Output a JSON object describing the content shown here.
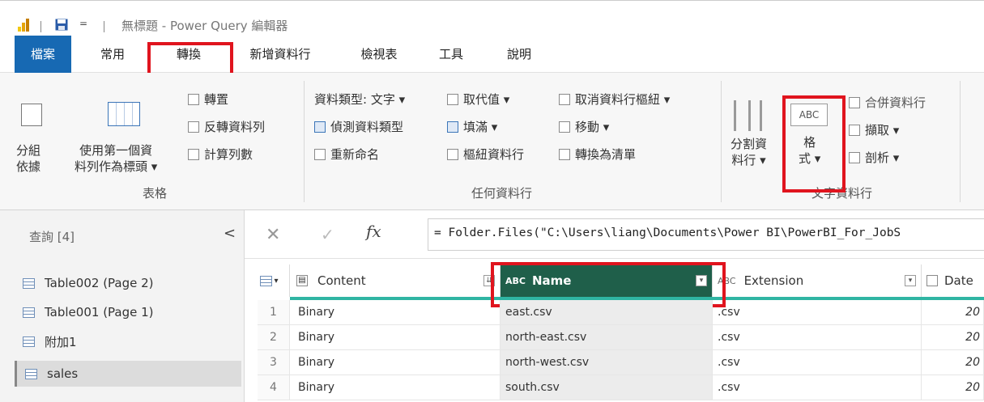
{
  "window": {
    "title": "無標題 - Power Query 編輯器",
    "qat_arrow": "="
  },
  "tabs": [
    {
      "label": "檔案"
    },
    {
      "label": "常用"
    },
    {
      "label": "轉換"
    },
    {
      "label": "新增資料行"
    },
    {
      "label": "檢視表"
    },
    {
      "label": "工具"
    },
    {
      "label": "說明"
    }
  ],
  "ribbon": {
    "group_table": {
      "label": "表格",
      "group_by": [
        "分組",
        "依據"
      ],
      "first_row_header": [
        "使用第一個資",
        "料列作為標頭 ▾"
      ],
      "transpose": "轉置",
      "reverse_rows": "反轉資料列",
      "count_rows": "計算列數"
    },
    "group_any_column": {
      "label": "任何資料行",
      "data_type": "資料類型: 文字 ▾",
      "detect_type": "偵測資料類型",
      "rename": "重新命名",
      "replace_values": "取代值 ▾",
      "fill": "填滿 ▾",
      "pivot_column": "樞紐資料行",
      "unpivot": "取消資料行樞紐 ▾",
      "move": "移動 ▾",
      "to_list": "轉換為清單"
    },
    "group_text_column": {
      "label": "文字資料行",
      "split_column": [
        "分割資",
        "料行 ▾"
      ],
      "format": [
        "格",
        "式 ▾"
      ],
      "format_icon_text": "ABC",
      "merge_columns": "合併資料行",
      "extract": "擷取 ▾",
      "parse": "剖析 ▾"
    }
  },
  "query_pane": {
    "header": "查詢 [4]",
    "collapse": "<",
    "items": [
      {
        "label": "Table002 (Page 2)"
      },
      {
        "label": "Table001 (Page 1)"
      },
      {
        "label": "附加1"
      },
      {
        "label": "sales"
      }
    ]
  },
  "formula_bar": {
    "fx": "fx",
    "formula": "= Folder.Files(\"C:\\Users\\liang\\Documents\\Power BI\\PowerBI_For_JobS"
  },
  "grid": {
    "columns": [
      {
        "label": "Content",
        "type_icon": "▤"
      },
      {
        "label": "Name",
        "type_icon": "ABC"
      },
      {
        "label": "Extension",
        "type_icon": "ABC"
      },
      {
        "label": "Date",
        "type_icon": "📅"
      }
    ],
    "rows": [
      {
        "n": "1",
        "content": "Binary",
        "name": "east.csv",
        "ext": ".csv",
        "date": "20"
      },
      {
        "n": "2",
        "content": "Binary",
        "name": "north-east.csv",
        "ext": ".csv",
        "date": "20"
      },
      {
        "n": "3",
        "content": "Binary",
        "name": "north-west.csv",
        "ext": ".csv",
        "date": "20"
      },
      {
        "n": "4",
        "content": "Binary",
        "name": "south.csv",
        "ext": ".csv",
        "date": "20"
      }
    ]
  },
  "colors": {
    "file_tab": "#1769b3",
    "highlight": "#e0141e",
    "name_header": "#1f5f4a",
    "teal_bar": "#2fb5a3"
  }
}
